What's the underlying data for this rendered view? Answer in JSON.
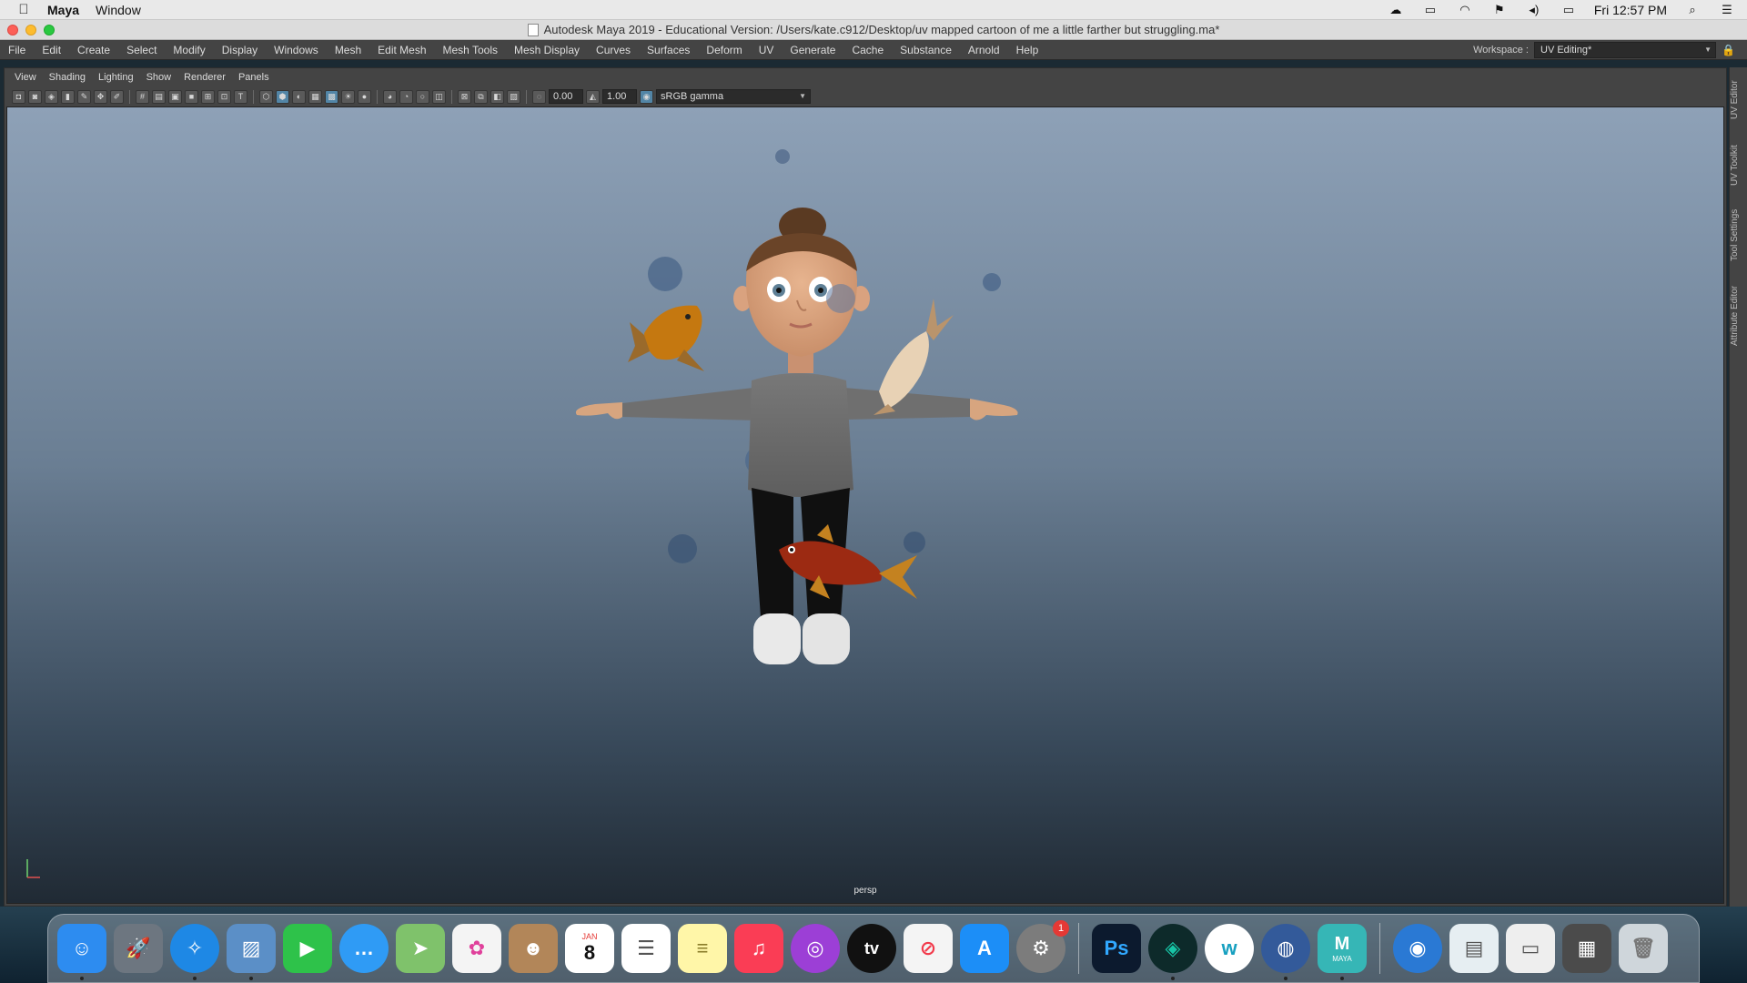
{
  "menubar": {
    "app_name": "Maya",
    "items": [
      "Window"
    ],
    "clock": "Fri 12:57 PM",
    "tray_icons": [
      "creative-cloud-icon",
      "airplay-icon",
      "wifi-icon",
      "flag-icon",
      "volume-icon",
      "battery-icon"
    ]
  },
  "titlebar": {
    "title": "Autodesk Maya 2019 - Educational Version: /Users/kate.c912/Desktop/uv mapped cartoon of me a little farther but struggling.ma*"
  },
  "maya_menu": {
    "items": [
      "File",
      "Edit",
      "Create",
      "Select",
      "Modify",
      "Display",
      "Windows",
      "Mesh",
      "Edit Mesh",
      "Mesh Tools",
      "Mesh Display",
      "Curves",
      "Surfaces",
      "Deform",
      "UV",
      "Generate",
      "Cache",
      "Substance",
      "Arnold",
      "Help"
    ],
    "workspace_label": "Workspace :",
    "workspace_value": "UV Editing*"
  },
  "panel_menu": {
    "items": [
      "View",
      "Shading",
      "Lighting",
      "Show",
      "Renderer",
      "Panels"
    ]
  },
  "toolbar": {
    "exposure": "0.00",
    "gamma": "1.00",
    "color_space": "sRGB gamma"
  },
  "viewport": {
    "camera": "persp",
    "background_top": "#8ea1b7",
    "background_bottom": "#202a34"
  },
  "side_tabs": [
    "UV Editor",
    "UV Toolkit",
    "Tool Settings",
    "Attribute Editor"
  ],
  "dock": {
    "apps": [
      {
        "name": "finder-icon",
        "color": "#2d8cf0"
      },
      {
        "name": "launchpad-icon",
        "color": "#6d7680"
      },
      {
        "name": "safari-icon",
        "color": "#1e88e5"
      },
      {
        "name": "preview-icon",
        "color": "#5b8fc7"
      },
      {
        "name": "facetime-icon",
        "color": "#2ec24a"
      },
      {
        "name": "messages-icon",
        "color": "#2f9bf5"
      },
      {
        "name": "maps-icon",
        "color": "#7fc26b"
      },
      {
        "name": "photos-icon",
        "color": "#f4f4f4"
      },
      {
        "name": "contacts-icon",
        "color": "#b28659"
      },
      {
        "name": "calendar-icon",
        "color": "#ffffff",
        "month": "JAN",
        "day": "8"
      },
      {
        "name": "reminders-icon",
        "color": "#ffffff"
      },
      {
        "name": "notes-icon",
        "color": "#fff6a8"
      },
      {
        "name": "music-icon",
        "color": "#fa3d55"
      },
      {
        "name": "podcasts-icon",
        "color": "#9c3fd6"
      },
      {
        "name": "tv-icon",
        "color": "#111111",
        "label": "tv"
      },
      {
        "name": "news-icon",
        "color": "#f4f4f4"
      },
      {
        "name": "app-store-icon",
        "color": "#1c8ef7"
      },
      {
        "name": "system-preferences-icon",
        "color": "#7c7c7c",
        "badge": "1"
      }
    ],
    "apps2": [
      {
        "name": "photoshop-icon",
        "color": "#0c1a2e",
        "label": "Ps"
      },
      {
        "name": "gitkraken-icon",
        "color": "#0d2a2a"
      },
      {
        "name": "webex-icon",
        "color": "#ffffff"
      },
      {
        "name": "network-icon",
        "color": "#335a9a"
      },
      {
        "name": "maya-icon",
        "color": "#36b6b6",
        "label": "MAYA"
      }
    ],
    "apps3": [
      {
        "name": "globe-icon",
        "color": "#2a79d4"
      },
      {
        "name": "documents-folder-icon",
        "color": "#e6eef2"
      },
      {
        "name": "downloads-stack-icon",
        "color": "#eeeeee"
      },
      {
        "name": "recent-files-stack-icon",
        "color": "#4b4b4b"
      },
      {
        "name": "trash-icon",
        "color": "#cfd6db"
      }
    ]
  }
}
